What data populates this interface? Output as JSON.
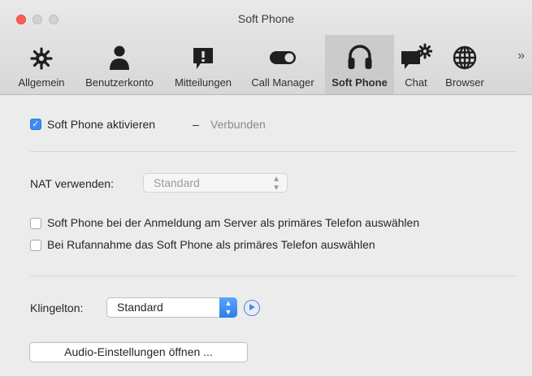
{
  "window": {
    "title": "Soft Phone"
  },
  "toolbar": {
    "tabs": [
      {
        "label": "Allgemein",
        "icon": "gear-icon"
      },
      {
        "label": "Benutzerkonto",
        "icon": "user-icon"
      },
      {
        "label": "Mitteilungen",
        "icon": "notification-icon"
      },
      {
        "label": "Call Manager",
        "icon": "toggle-icon"
      },
      {
        "label": "Soft Phone",
        "icon": "headset-icon",
        "selected": true
      },
      {
        "label": "Chat",
        "icon": "chat-settings-icon"
      },
      {
        "label": "Browser",
        "icon": "globe-icon"
      }
    ],
    "overflow": "»"
  },
  "enable": {
    "label": "Soft Phone aktivieren",
    "dash": "–",
    "status": "Verbunden",
    "checked": true
  },
  "nat": {
    "label": "NAT verwenden:",
    "value": "Standard",
    "disabled": true
  },
  "options": {
    "primary_on_login": {
      "label": "Soft Phone bei der Anmeldung am Server als primäres Telefon auswählen",
      "checked": false
    },
    "primary_on_answer": {
      "label": "Bei Rufannahme das Soft Phone als primäres Telefon auswählen",
      "checked": false
    }
  },
  "ringtone": {
    "label": "Klingelton:",
    "value": "Standard"
  },
  "audio_button": {
    "label": "Audio-Einstellungen öffnen ..."
  },
  "colors": {
    "accent": "#3b8cf5",
    "close": "#ff5f57"
  }
}
